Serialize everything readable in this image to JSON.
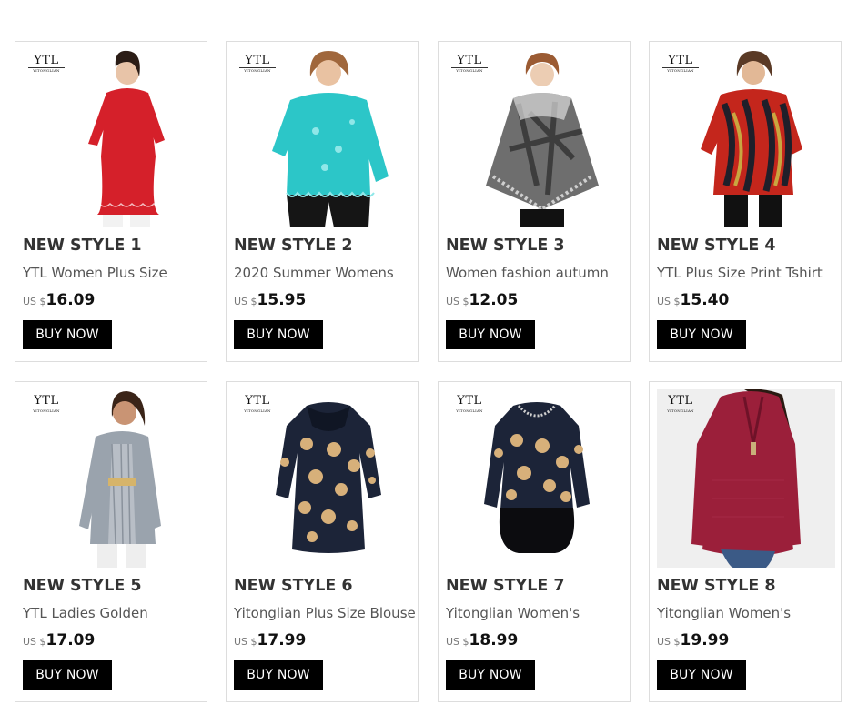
{
  "brand_logo": {
    "line1": "YTL",
    "line2": "YITONGLIAN"
  },
  "buy_label": "BUY NOW",
  "currency_prefix": "US $",
  "products": [
    {
      "style": "NEW STYLE 1",
      "name": "YTL Women Plus Size",
      "price": "16.09",
      "pattern": "red-lace",
      "colors": [
        "#d5202a",
        "#ffffff"
      ]
    },
    {
      "style": "NEW STYLE 2",
      "name": "2020 Summer Womens",
      "price": "15.95",
      "pattern": "turquoise-lace",
      "colors": [
        "#2cc6c8",
        "#1a1a1a"
      ]
    },
    {
      "style": "NEW STYLE 3",
      "name": "Women fashion autumn",
      "price": "12.05",
      "pattern": "grey-tie-dye",
      "colors": [
        "#6e6e6e",
        "#1a1a1a"
      ]
    },
    {
      "style": "NEW STYLE 4",
      "name": "YTL Plus Size Print Tshirt",
      "price": "15.40",
      "pattern": "red-print",
      "colors": [
        "#c4261c",
        "#1f1f2a"
      ]
    },
    {
      "style": "NEW STYLE 5",
      "name": "YTL Ladies Golden",
      "price": "17.09",
      "pattern": "grey-lace",
      "colors": [
        "#9aa3ad",
        "#e6e6e6"
      ]
    },
    {
      "style": "NEW STYLE 6",
      "name": "Yitonglian Plus Size Blouse",
      "price": "17.99",
      "pattern": "navy-floral",
      "colors": [
        "#1c2438",
        "#d7b07a"
      ]
    },
    {
      "style": "NEW STYLE 7",
      "name": "Yitonglian Women's",
      "price": "18.99",
      "pattern": "navy-floral-hem",
      "colors": [
        "#1c2438",
        "#d7b07a"
      ]
    },
    {
      "style": "NEW STYLE 8",
      "name": "Yitonglian Women's",
      "price": "19.99",
      "pattern": "burgundy-zip",
      "colors": [
        "#9b1f3a",
        "#3b5a86"
      ]
    }
  ]
}
